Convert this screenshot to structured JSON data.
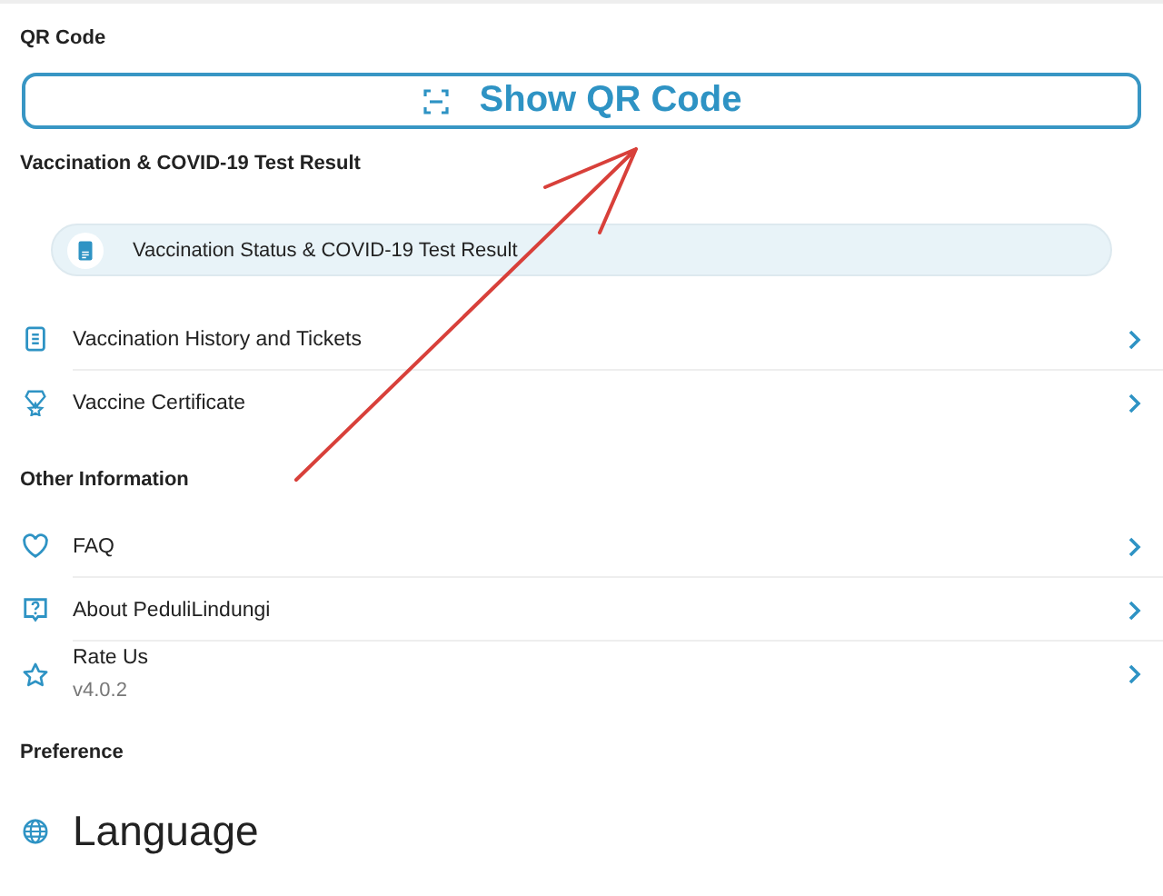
{
  "sections": [
    {
      "title": "QR Code",
      "kind": "button",
      "button": {
        "label": "Show QR Code"
      }
    },
    {
      "title": "Vaccination & COVID-19 Test Result",
      "kind": "list",
      "banner": {
        "label": "Vaccination Status & COVID-19 Test Result"
      },
      "items": [
        {
          "kind": "list",
          "label": "Vaccination History and Tickets",
          "chevron": true
        },
        {
          "kind": "award",
          "label": "Vaccine Certificate",
          "chevron": true
        }
      ]
    },
    {
      "title": "Other Information",
      "kind": "list",
      "items": [
        {
          "kind": "heart",
          "label": "FAQ",
          "chevron": true
        },
        {
          "kind": "help",
          "label": "About PeduliLindungi",
          "chevron": true
        },
        {
          "kind": "star",
          "label": "Rate Us",
          "subtitle": "v4.0.2",
          "chevron": true
        }
      ]
    },
    {
      "title": "Preference",
      "kind": "large",
      "items": [
        {
          "kind": "globe",
          "label": "Language",
          "chevron": false
        }
      ]
    }
  ]
}
